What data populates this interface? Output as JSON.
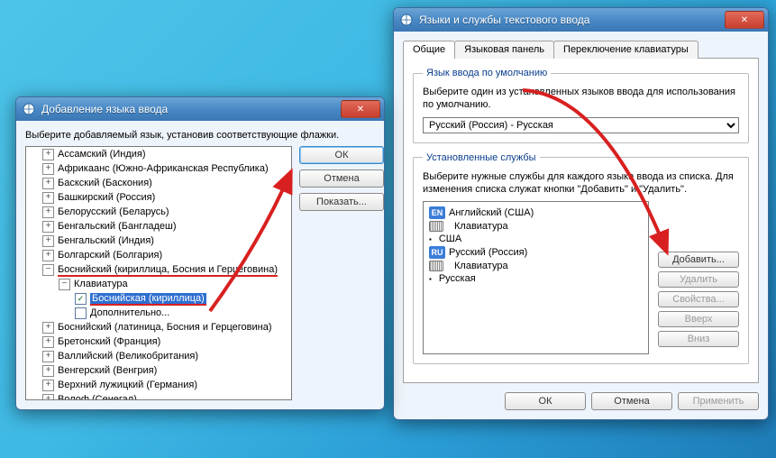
{
  "dlg2": {
    "title": "Языки и службы текстового ввода",
    "tabs": [
      "Общие",
      "Языковая панель",
      "Переключение клавиатуры"
    ],
    "group1": {
      "legend": "Язык ввода по умолчанию",
      "desc": "Выберите один из установленных языков ввода для использования по умолчанию.",
      "combo": "Русский (Россия) - Русская"
    },
    "group2": {
      "legend": "Установленные службы",
      "desc": "Выберите нужные службы для каждого языка ввода из списка. Для изменения списка служат кнопки \"Добавить\" и \"Удалить\".",
      "tree": {
        "en_label": "Английский (США)",
        "en_kb": "Клавиатура",
        "en_layout": "США",
        "ru_label": "Русский (Россия)",
        "ru_kb": "Клавиатура",
        "ru_layout": "Русская"
      },
      "buttons": {
        "add": "Добавить...",
        "remove": "Удалить",
        "props": "Свойства...",
        "up": "Вверх",
        "down": "Вниз"
      }
    },
    "buttons": {
      "ok": "ОК",
      "cancel": "Отмена",
      "apply": "Применить"
    }
  },
  "dlg1": {
    "title": "Добавление языка ввода",
    "instr": "Выберите добавляемый язык, установив соответствующие флажки.",
    "items": [
      {
        "t": "node",
        "label": "Ассамский (Индия)"
      },
      {
        "t": "node",
        "label": "Африкаанс (Южно-Африканская Республика)"
      },
      {
        "t": "node",
        "label": "Баскский (Баскония)"
      },
      {
        "t": "node",
        "label": "Башкирский (Россия)"
      },
      {
        "t": "node",
        "label": "Белорусский (Беларусь)"
      },
      {
        "t": "node",
        "label": "Бенгальский (Бангладеш)"
      },
      {
        "t": "node",
        "label": "Бенгальский (Индия)"
      },
      {
        "t": "node",
        "label": "Болгарский (Болгария)"
      },
      {
        "t": "open",
        "label": "Боснийский (кириллица, Босния и Герцеговина)",
        "mark": true
      },
      {
        "t": "sub-open",
        "label": "Клавиатура"
      },
      {
        "t": "leaf",
        "label": "Боснийская (кириллица)",
        "checked": true,
        "selected": true,
        "mark": true
      },
      {
        "t": "leaf",
        "label": "Дополнительно..."
      },
      {
        "t": "node",
        "label": "Боснийский (латиница, Босния и Герцеговина)"
      },
      {
        "t": "node",
        "label": "Бретонский (Франция)"
      },
      {
        "t": "node",
        "label": "Валлийский (Великобритания)"
      },
      {
        "t": "node",
        "label": "Венгерский (Венгрия)"
      },
      {
        "t": "node",
        "label": "Верхний лужицкий (Германия)"
      },
      {
        "t": "node",
        "label": "Волоф (Сенегал)"
      }
    ],
    "buttons": {
      "ok": "ОК",
      "cancel": "Отмена",
      "show": "Показать..."
    }
  }
}
